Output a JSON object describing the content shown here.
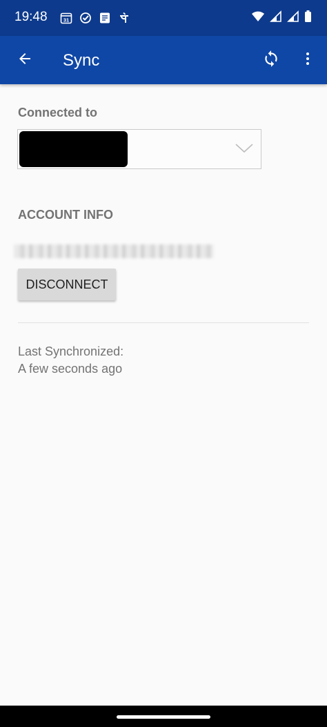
{
  "status_bar": {
    "time": "19:48",
    "calendar_day": "31",
    "left_icons": [
      "calendar-icon",
      "check-circle-icon",
      "docs-icon",
      "pe-icon"
    ],
    "right_icons": [
      "wifi-icon",
      "signal-icon",
      "signal-icon",
      "battery-icon"
    ]
  },
  "app_bar": {
    "title": "Sync",
    "back_icon": "arrow-back-icon",
    "sync_icon": "sync-icon",
    "more_icon": "more-vert-icon"
  },
  "connected": {
    "label": "Connected to",
    "selected_value": "",
    "chevron_icon": "chevron-down-icon"
  },
  "account": {
    "label": "ACCOUNT INFO",
    "email": "",
    "disconnect_label": "DISCONNECT"
  },
  "last_sync": {
    "label": "Last Synchronized:",
    "value": "A few seconds ago"
  },
  "colors": {
    "status_bar": "#0d3a8c",
    "app_bar": "#0f47a6",
    "label_gray": "#737373",
    "button_bg": "#d9d9d9"
  }
}
